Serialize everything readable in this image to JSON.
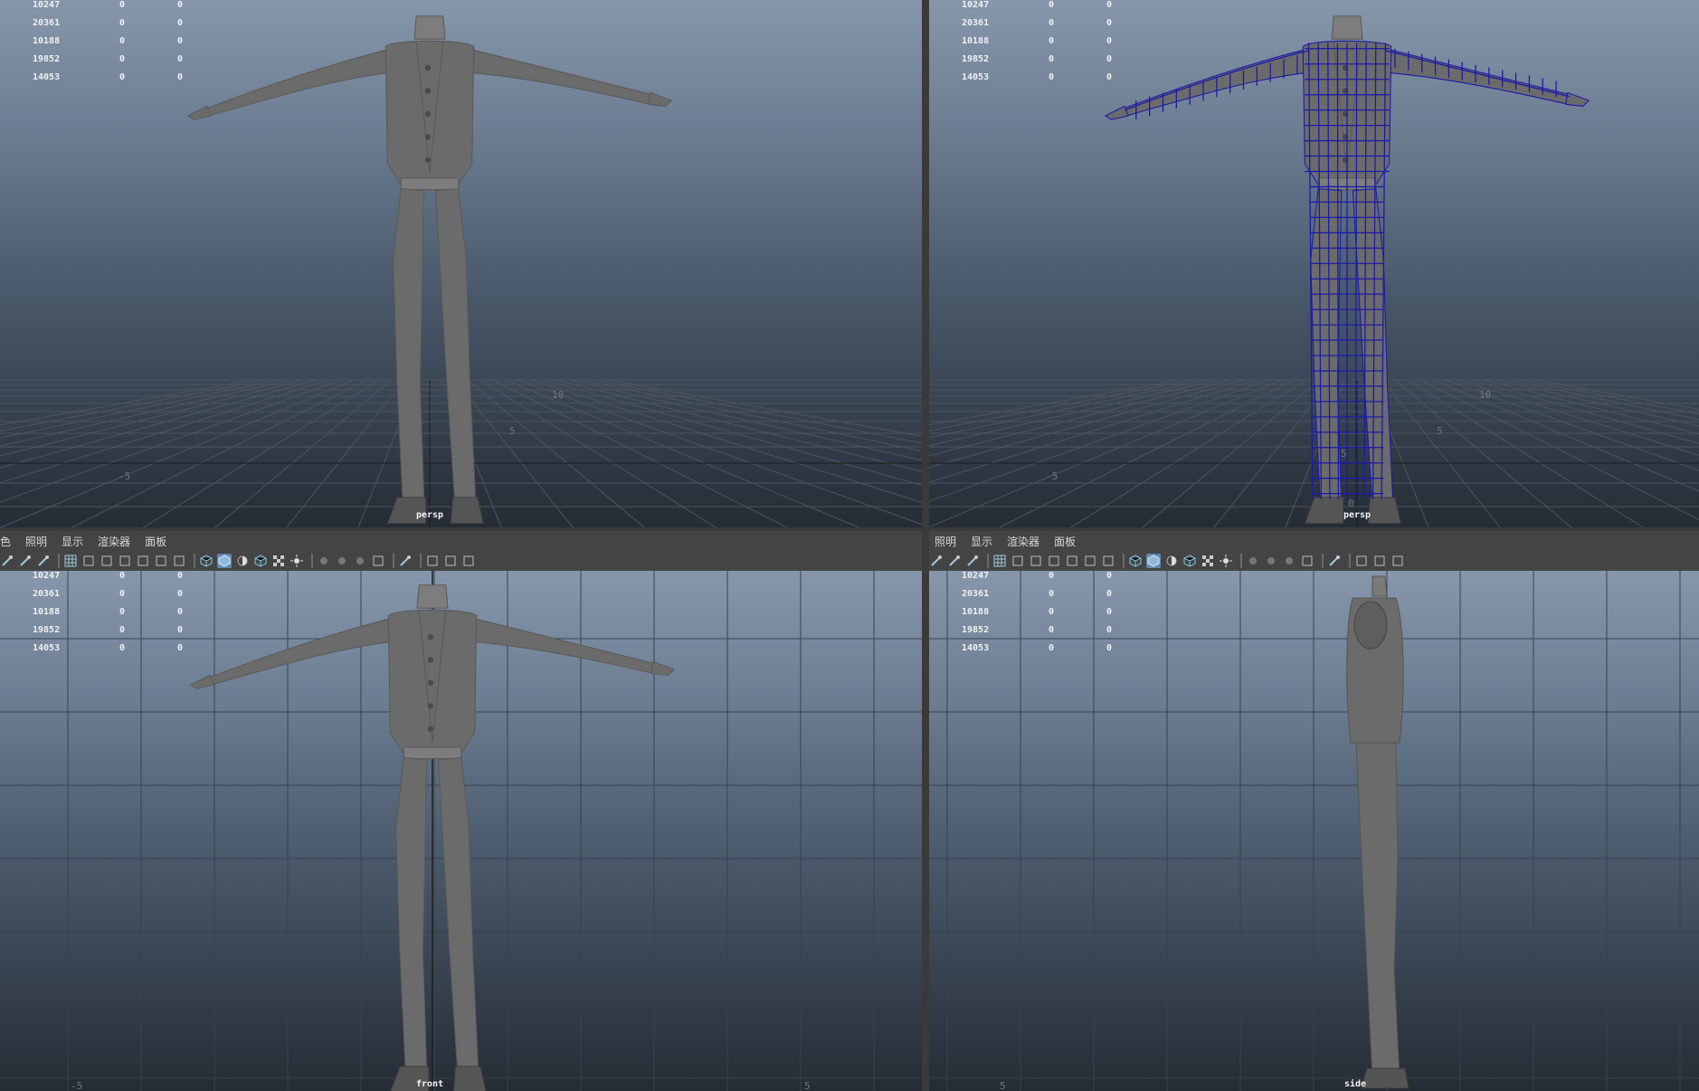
{
  "hud_rows": [
    [
      "10247",
      "0",
      "0"
    ],
    [
      "20361",
      "0",
      "0"
    ],
    [
      "10188",
      "0",
      "0"
    ],
    [
      "19852",
      "0",
      "0"
    ],
    [
      "14053",
      "0",
      "0"
    ]
  ],
  "viewports": {
    "top_left": {
      "camera": "persp",
      "display": "smooth-shaded"
    },
    "top_right": {
      "camera": "persp",
      "display": "wireframe-on-shaded"
    },
    "bottom_left": {
      "camera": "front",
      "display": "smooth-shaded"
    },
    "bottom_right": {
      "camera": "side",
      "display": "smooth-shaded"
    }
  },
  "panel_menus": {
    "left": [
      "色",
      "照明",
      "显示",
      "渲染器",
      "面板"
    ],
    "right": [
      "照明",
      "显示",
      "渲染器",
      "面板"
    ]
  },
  "grid_labels": {
    "persp": [
      "5",
      "0",
      "-5",
      "5",
      "10"
    ],
    "front": [
      "-5",
      "5"
    ],
    "side": [
      "5"
    ]
  },
  "toolbar_icons": [
    "select-camera-icon",
    "lock-camera-icon",
    "bookmark-icon",
    "image-plane-icon",
    "grid-icon",
    "film-gate-icon",
    "resolution-gate-icon",
    "gate-mask-icon",
    "field-chart-icon",
    "safe-action-icon",
    "safe-title-icon",
    "wireframe-icon",
    "smooth-shade-icon",
    "wireframe-on-shaded-icon",
    "textured-icon",
    "use-lights-icon",
    "shadows-icon",
    "screen-space-ao-icon",
    "motion-blur-icon",
    "anti-alias-icon",
    "depth-of-field-icon",
    "isolate-select-icon",
    "xray-icon",
    "xray-joints-icon",
    "backface-icon"
  ],
  "colors": {
    "wireframe": "#1a1aa8",
    "model": "#6b6b6b",
    "active_icon": "#5d8ab1"
  }
}
